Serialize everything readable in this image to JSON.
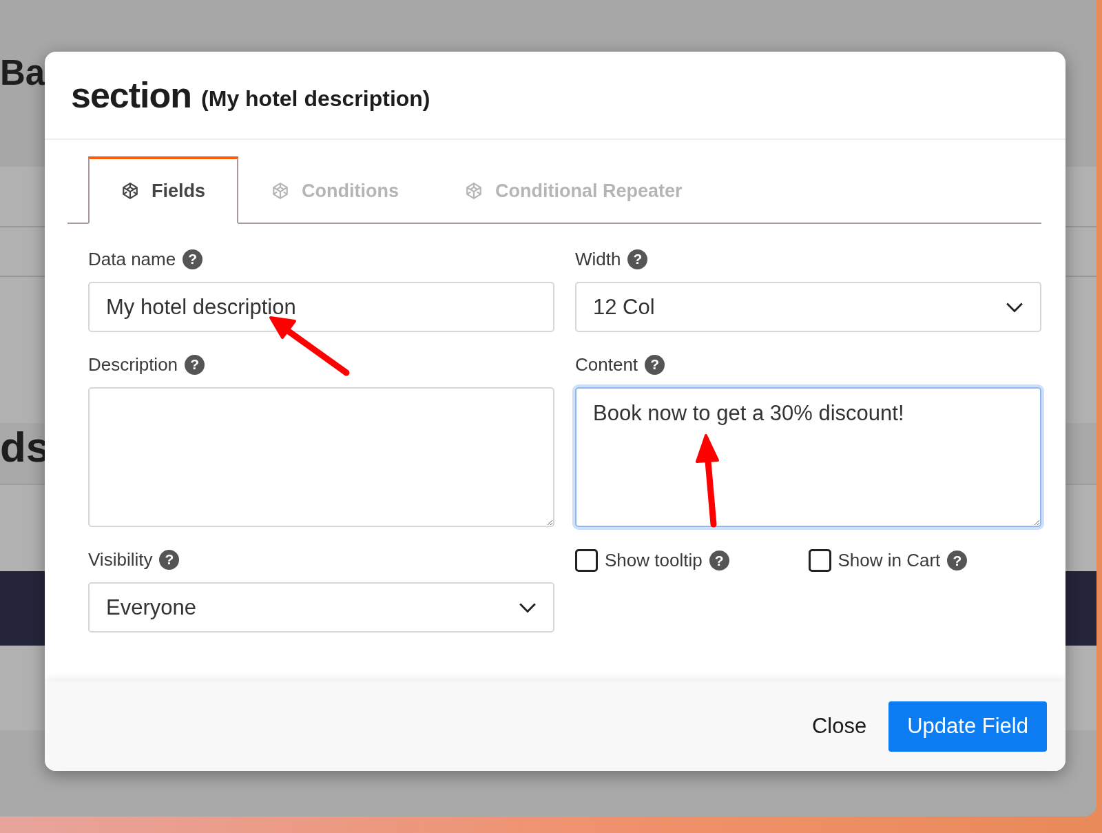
{
  "background_page": {
    "heading_1": "Ba",
    "heading_2": "ds"
  },
  "modal": {
    "title": "section",
    "subtitle": "(My hotel description)",
    "tabs": [
      {
        "label": "Fields",
        "selected": true
      },
      {
        "label": "Conditions",
        "selected": false
      },
      {
        "label": "Conditional Repeater",
        "selected": false
      }
    ],
    "fields": [
      {
        "kind": "text",
        "label": "Data name",
        "help": "?",
        "value": "My hotel description",
        "focused": false
      },
      {
        "kind": "select",
        "label": "Width",
        "help": "?",
        "value": "12 Col",
        "focused": false
      },
      {
        "kind": "textarea",
        "label": "Description",
        "help": "?",
        "focused": false
      },
      {
        "kind": "textarea",
        "label": "Content",
        "help": "?",
        "value": "Book now to get a 30% discount!",
        "focused": true
      },
      {
        "kind": "select",
        "label": "Visibility",
        "help": "?",
        "value": "Everyone",
        "focused": false
      },
      {
        "kind": "checkboxes",
        "options": [
          {
            "label": "Show tooltip",
            "help": "?",
            "checked": false
          },
          {
            "label": "Show in Cart",
            "help": "?",
            "checked": false
          }
        ]
      }
    ],
    "buttons": [
      {
        "label": "Close",
        "kind": "plain"
      },
      {
        "label": "Update Field",
        "kind": "primary"
      }
    ]
  }
}
